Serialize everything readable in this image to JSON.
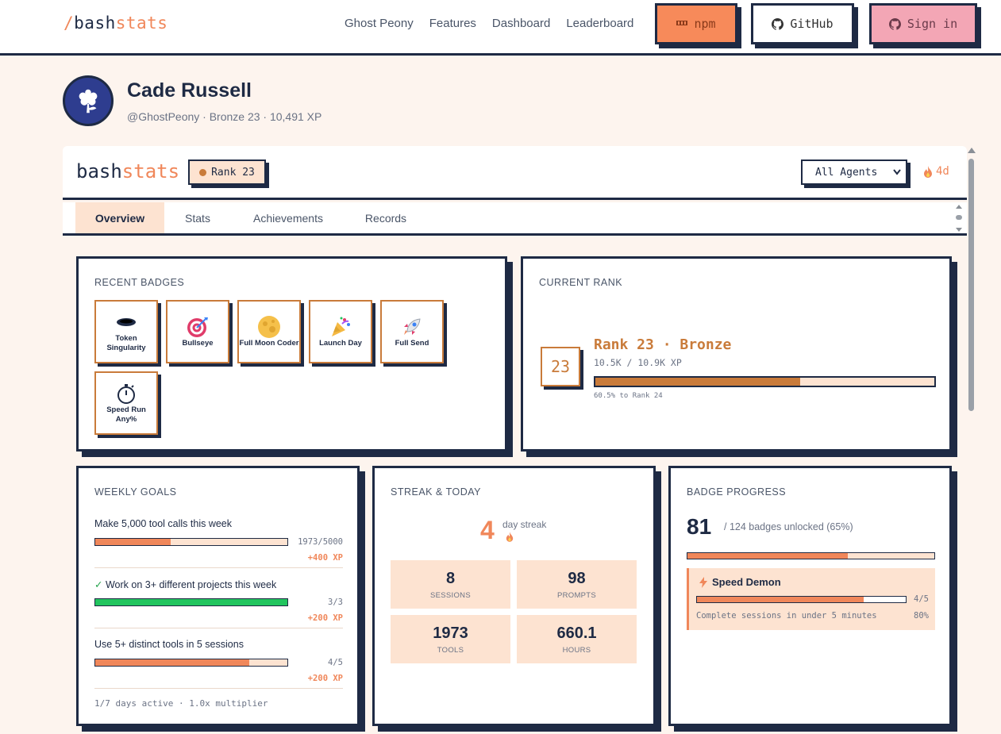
{
  "nav": {
    "logo_slash": "/",
    "logo_dark": "bash",
    "logo_accent": "stats",
    "links": [
      "Ghost Peony",
      "Features",
      "Dashboard",
      "Leaderboard"
    ],
    "npm_label": "npm",
    "github_label": "GitHub",
    "signin_label": "Sign in"
  },
  "profile": {
    "name": "Cade Russell",
    "subtitle": "@GhostPeony · Bronze 23 · 10,491 XP"
  },
  "widget": {
    "logo_dark": "bash",
    "logo_accent": "stats",
    "rank_pill": "Rank 23",
    "agent_select": "All Agents",
    "streak": "4d",
    "tabs": [
      "Overview",
      "Stats",
      "Achievements",
      "Records"
    ],
    "active_tab": "Overview"
  },
  "recent_badges": {
    "title": "RECENT BADGES",
    "items": [
      {
        "label": "Token Singularity",
        "icon": "black-hole-icon"
      },
      {
        "label": "Bullseye",
        "icon": "target-icon"
      },
      {
        "label": "Full Moon Coder",
        "icon": "moon-icon"
      },
      {
        "label": "Launch Day",
        "icon": "party-popper-icon"
      },
      {
        "label": "Full Send",
        "icon": "rocket-icon"
      },
      {
        "label": "Speed Run Any%",
        "icon": "stopwatch-icon"
      }
    ]
  },
  "current_rank": {
    "title": "CURRENT RANK",
    "number": "23",
    "label": "Rank 23 · Bronze",
    "xp": "10.5K / 10.9K XP",
    "progress": 0.605,
    "note": "60.5% to Rank 24"
  },
  "weekly_goals": {
    "title": "WEEKLY GOALS",
    "goals": [
      {
        "check": "",
        "text": "Make 5,000 tool calls this week",
        "count": "1973/5000",
        "xp": "+400 XP",
        "progress": 0.3946,
        "complete": false
      },
      {
        "check": "✓",
        "text": "Work on 3+ different projects this week",
        "count": "3/3",
        "xp": "+200 XP",
        "progress": 1.0,
        "complete": true
      },
      {
        "check": "",
        "text": "Use 5+ distinct tools in 5 sessions",
        "count": "4/5",
        "xp": "+200 XP",
        "progress": 0.8,
        "complete": false
      }
    ],
    "footer": "1/7 days active · 1.0x multiplier"
  },
  "streak_today": {
    "title": "STREAK & TODAY",
    "streak_number": "4",
    "streak_label": "day streak",
    "stats": [
      {
        "value": "8",
        "label": "SESSIONS"
      },
      {
        "value": "98",
        "label": "PROMPTS"
      },
      {
        "value": "1973",
        "label": "TOOLS"
      },
      {
        "value": "660.1",
        "label": "HOURS"
      }
    ]
  },
  "badge_progress": {
    "title": "BADGE PROGRESS",
    "count": "81",
    "subtitle": "/ 124 badges unlocked (65%)",
    "progress": 0.65,
    "next": {
      "name": "Speed Demon",
      "count": "4/5",
      "progress": 0.8,
      "description": "Complete sessions in under 5 minutes",
      "percent": "80%"
    }
  },
  "colors": {
    "accent": "#f0875a",
    "bronze": "#c97b3a",
    "navy": "#1e2a44",
    "peach": "#fde3d1",
    "success": "#22c55e"
  }
}
